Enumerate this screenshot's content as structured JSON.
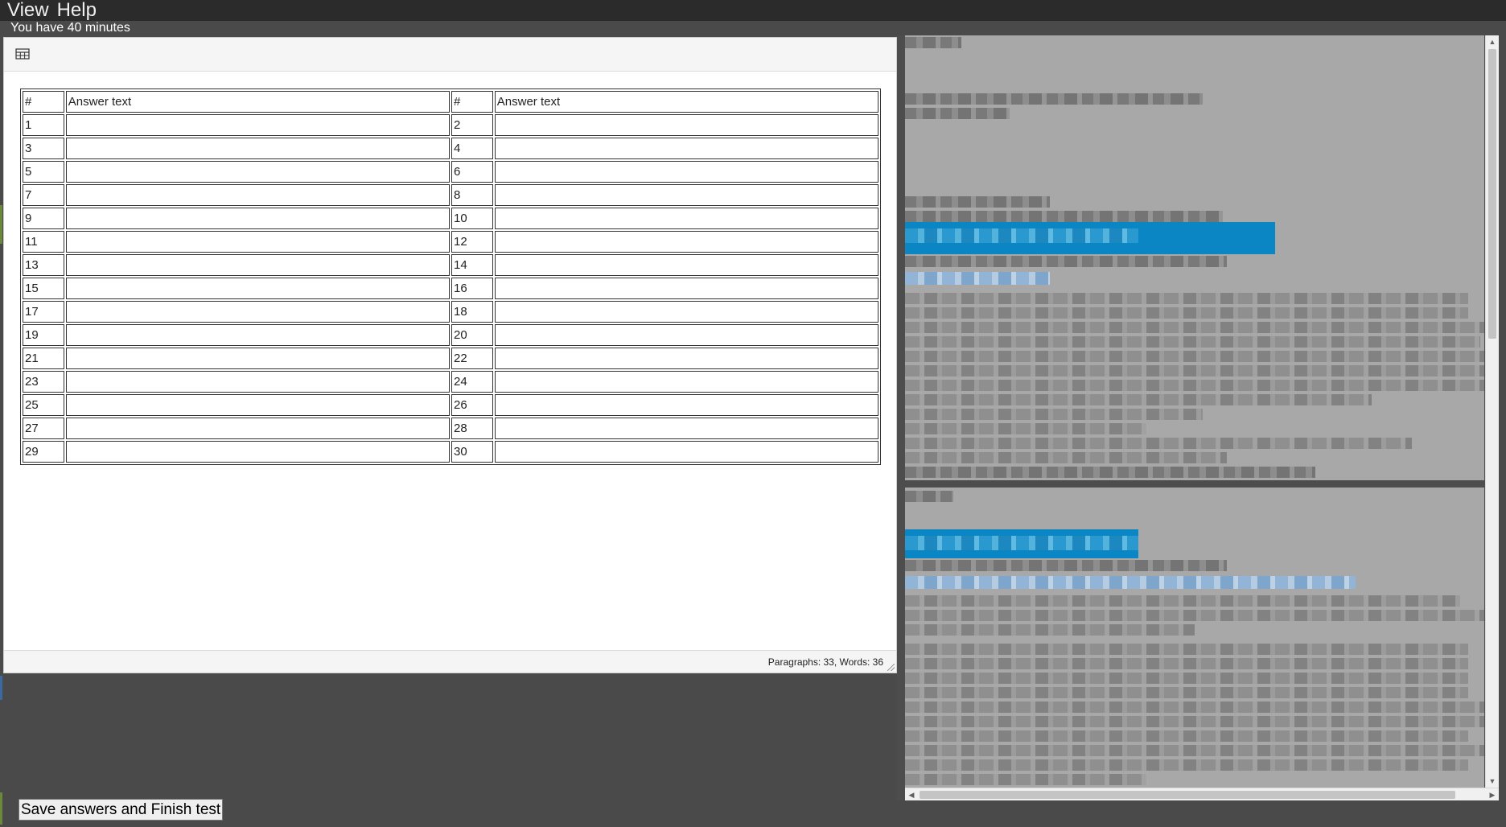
{
  "menubar": {
    "items": [
      "View",
      "Help"
    ]
  },
  "timer": {
    "text": "You have 40 minutes"
  },
  "editor": {
    "toolbar": {
      "table_icon": "table-icon"
    },
    "table": {
      "headers": [
        "#",
        "Answer text",
        "#",
        "Answer text"
      ],
      "rows": [
        [
          "1",
          "",
          "2",
          ""
        ],
        [
          "3",
          "",
          "4",
          ""
        ],
        [
          "5",
          "",
          "6",
          ""
        ],
        [
          "7",
          "",
          "8",
          ""
        ],
        [
          "9",
          "",
          "10",
          ""
        ],
        [
          "11",
          "",
          "12",
          ""
        ],
        [
          "13",
          "",
          "14",
          ""
        ],
        [
          "15",
          "",
          "16",
          ""
        ],
        [
          "17",
          "",
          "18",
          ""
        ],
        [
          "19",
          "",
          "20",
          ""
        ],
        [
          "21",
          "",
          "22",
          ""
        ],
        [
          "23",
          "",
          "24",
          ""
        ],
        [
          "25",
          "",
          "26",
          ""
        ],
        [
          "27",
          "",
          "28",
          ""
        ],
        [
          "29",
          "",
          "30",
          ""
        ]
      ]
    },
    "status": {
      "text": "Paragraphs: 33, Words: 36"
    }
  },
  "viewer": {
    "content": "blurred-document"
  },
  "footer": {
    "finish_label": "Save answers and Finish test"
  },
  "colors": {
    "menubar_bg": "#2b2b2b",
    "body_bg": "#4a4a4a",
    "highlight_blue": "#0b86c4"
  }
}
